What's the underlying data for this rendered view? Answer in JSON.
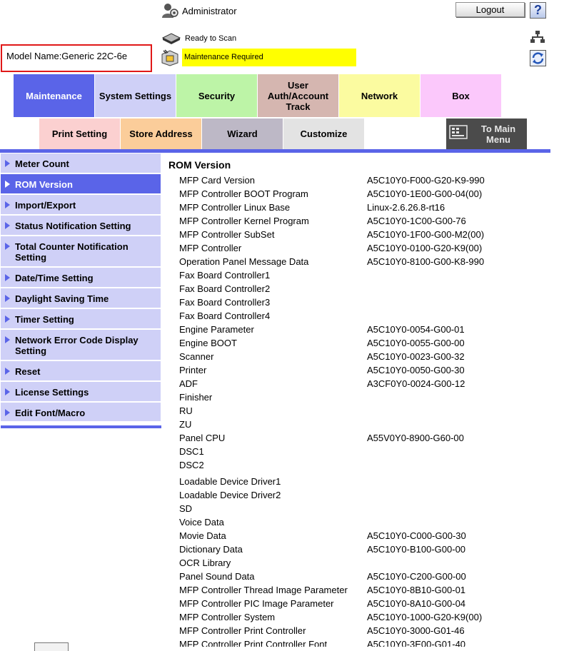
{
  "header": {
    "user_label": "Administrator",
    "logout_label": "Logout",
    "help_label": "?",
    "scan_status": "Ready to Scan",
    "maintenance_status": "Maintenance Required",
    "model_name": "Model Name:Generic 22C-6e"
  },
  "main_tabs": [
    {
      "label": "Maintenance",
      "active": true
    },
    {
      "label": "System Settings"
    },
    {
      "label": "Security"
    },
    {
      "label": "User Auth/Account Track"
    },
    {
      "label": "Network"
    },
    {
      "label": "Box"
    }
  ],
  "sub_tabs": [
    "Print Setting",
    "Store Address",
    "Wizard",
    "Customize"
  ],
  "to_main_menu": "To Main Menu",
  "sidebar": {
    "items": [
      {
        "label": "Meter Count"
      },
      {
        "label": "ROM Version",
        "active": true
      },
      {
        "label": "Import/Export"
      },
      {
        "label": "Status Notification Setting"
      },
      {
        "label": "Total Counter Notification Setting"
      },
      {
        "label": "Date/Time Setting"
      },
      {
        "label": "Daylight Saving Time"
      },
      {
        "label": "Timer Setting"
      },
      {
        "label": "Network Error Code Display Setting"
      },
      {
        "label": "Reset"
      },
      {
        "label": "License Settings"
      },
      {
        "label": "Edit Font/Macro"
      }
    ]
  },
  "content": {
    "title": "ROM Version",
    "rows": [
      {
        "name": "MFP Card Version",
        "value": "A5C10Y0-F000-G20-K9-990"
      },
      {
        "name": "MFP Controller BOOT Program",
        "value": "A5C10Y0-1E00-G00-04(00)"
      },
      {
        "name": "MFP Controller Linux Base",
        "value": "Linux-2.6.26.8-rt16"
      },
      {
        "name": "MFP Controller Kernel Program",
        "value": "A5C10Y0-1C00-G00-76"
      },
      {
        "name": "MFP Controller SubSet",
        "value": "A5C10Y0-1F00-G00-M2(00)"
      },
      {
        "name": "MFP Controller",
        "value": "A5C10Y0-0100-G20-K9(00)"
      },
      {
        "name": "Operation Panel Message Data",
        "value": "A5C10Y0-8100-G00-K8-990"
      },
      {
        "name": "Fax Board Controller1",
        "value": ""
      },
      {
        "name": "Fax Board Controller2",
        "value": ""
      },
      {
        "name": "Fax Board Controller3",
        "value": ""
      },
      {
        "name": "Fax Board Controller4",
        "value": ""
      },
      {
        "name": "Engine Parameter",
        "value": "A5C10Y0-0054-G00-01"
      },
      {
        "name": "Engine BOOT",
        "value": "A5C10Y0-0055-G00-00"
      },
      {
        "name": "Scanner",
        "value": "A5C10Y0-0023-G00-32"
      },
      {
        "name": "Printer",
        "value": "A5C10Y0-0050-G00-30"
      },
      {
        "name": "ADF",
        "value": "A3CF0Y0-0024-G00-12"
      },
      {
        "name": "Finisher",
        "value": ""
      },
      {
        "name": "RU",
        "value": ""
      },
      {
        "name": "ZU",
        "value": ""
      },
      {
        "name": "Panel CPU",
        "value": "A55V0Y0-8900-G60-00"
      },
      {
        "name": "DSC1",
        "value": ""
      },
      {
        "name": "DSC2",
        "value": ""
      },
      {
        "name": "Loadable Device Driver1",
        "value": ""
      },
      {
        "name": "Loadable Device Driver2",
        "value": ""
      },
      {
        "name": "SD",
        "value": ""
      },
      {
        "name": "Voice Data",
        "value": ""
      },
      {
        "name": "Movie Data",
        "value": "A5C10Y0-C000-G00-30"
      },
      {
        "name": "Dictionary Data",
        "value": "A5C10Y0-B100-G00-00"
      },
      {
        "name": "OCR Library",
        "value": ""
      },
      {
        "name": "Panel Sound Data",
        "value": "A5C10Y0-C200-G00-00"
      },
      {
        "name": "MFP Controller Thread Image Parameter",
        "value": "A5C10Y0-8B10-G00-01"
      },
      {
        "name": "MFP Controller PIC Image Parameter",
        "value": "A5C10Y0-8A10-G00-04"
      },
      {
        "name": "MFP Controller System",
        "value": "A5C10Y0-1000-G20-K9(00)"
      },
      {
        "name": "MFP Controller Print Controller",
        "value": "A5C10Y0-3000-G01-46"
      },
      {
        "name": "MFP Controller Print Controller Font",
        "value": "A5C10Y0-3E00-G01-40"
      }
    ]
  },
  "icons": {
    "user": "user-icon",
    "scanner": "scanner-icon",
    "maintenance": "maintenance-icon",
    "network": "network-icon",
    "refresh": "refresh-icon",
    "main_menu": "main-menu-icon"
  },
  "colors": {
    "accent": "#5a64e8",
    "sidebar": "#cfd0f7",
    "warning": "#ffff00",
    "model_border": "#e01818"
  }
}
